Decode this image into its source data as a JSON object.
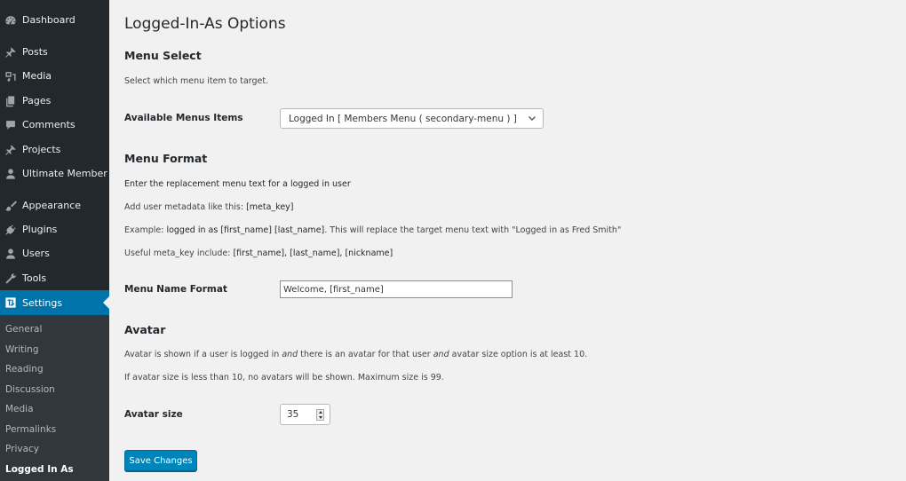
{
  "sidebar": {
    "items": [
      {
        "label": "Dashboard",
        "icon": "dashboard-icon"
      },
      {
        "label": "Posts",
        "icon": "pin-icon"
      },
      {
        "label": "Media",
        "icon": "media-icon"
      },
      {
        "label": "Pages",
        "icon": "pages-icon"
      },
      {
        "label": "Comments",
        "icon": "comment-icon"
      },
      {
        "label": "Projects",
        "icon": "pin-icon"
      },
      {
        "label": "Ultimate Member",
        "icon": "user-icon"
      },
      {
        "label": "Appearance",
        "icon": "paintbrush-icon"
      },
      {
        "label": "Plugins",
        "icon": "plugin-icon"
      },
      {
        "label": "Users",
        "icon": "user-icon"
      },
      {
        "label": "Tools",
        "icon": "wrench-icon"
      },
      {
        "label": "Settings",
        "icon": "settings-icon",
        "active": true
      }
    ],
    "submenu": [
      {
        "label": "General"
      },
      {
        "label": "Writing"
      },
      {
        "label": "Reading"
      },
      {
        "label": "Discussion"
      },
      {
        "label": "Media"
      },
      {
        "label": "Permalinks"
      },
      {
        "label": "Privacy"
      },
      {
        "label": "Logged In As",
        "current": true
      }
    ]
  },
  "main": {
    "title": "Logged-In-As Options",
    "menu_select": {
      "heading": "Menu Select",
      "description": "Select which menu item to target.",
      "field_label": "Available Menus Items",
      "selected_value": "Logged In [ Members Menu ( secondary-menu ) ]"
    },
    "menu_format": {
      "heading": "Menu Format",
      "line1": "Enter the replacement menu text for a logged in user",
      "line2_prefix": "Add user metadata like this: ",
      "line2_code": "[meta_key]",
      "line3_prefix": "Example: ",
      "line3_code": "logged in as [first_name] [last_name]",
      "line3_suffix": ". This will replace the target menu text with \"Logged in as Fred Smith\"",
      "line4_prefix": "Useful meta_key include: ",
      "line4_code": "[first_name], [last_name], [nickname]",
      "field_label": "Menu Name Format",
      "field_value": "Welcome, [first_name]"
    },
    "avatar": {
      "heading": "Avatar",
      "line1_a": "Avatar is shown if a user is logged in ",
      "line1_em1": "and",
      "line1_b": " there is an avatar for that user ",
      "line1_em2": "and",
      "line1_c": " avatar size option is at least 10.",
      "line2": "If avatar size is less than 10, no avatars will be shown. Maximum size is 99.",
      "field_label": "Avatar size",
      "field_value": "35"
    },
    "save_label": "Save Changes"
  }
}
